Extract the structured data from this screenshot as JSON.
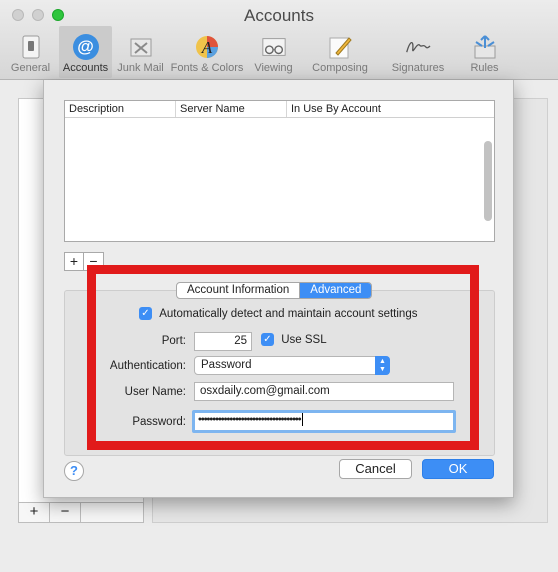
{
  "window": {
    "title": "Accounts"
  },
  "toolbar": {
    "items": [
      {
        "label": "General",
        "icon": "general-switch-icon"
      },
      {
        "label": "Accounts",
        "icon": "at-sign-icon",
        "selected": true
      },
      {
        "label": "Junk Mail",
        "icon": "junk-mail-icon"
      },
      {
        "label": "Fonts & Colors",
        "icon": "fonts-colors-icon"
      },
      {
        "label": "Viewing",
        "icon": "glasses-icon"
      },
      {
        "label": "Composing",
        "icon": "pencil-icon"
      },
      {
        "label": "Signatures",
        "icon": "signature-icon"
      },
      {
        "label": "Rules",
        "icon": "rules-arrows-icon"
      }
    ]
  },
  "smtp_table": {
    "columns": [
      "Description",
      "Server Name",
      "In Use By Account"
    ],
    "rows": []
  },
  "list_buttons": {
    "add": "+",
    "remove": "−"
  },
  "tabs": {
    "items": [
      "Account Information",
      "Advanced"
    ],
    "active": "Advanced"
  },
  "form": {
    "auto_detect_label": "Automatically detect and maintain account settings",
    "auto_detect_checked": true,
    "port_label": "Port:",
    "port_value": "25",
    "use_ssl_label": "Use SSL",
    "use_ssl_checked": true,
    "auth_label": "Authentication:",
    "auth_value": "Password",
    "username_label": "User Name:",
    "username_value": "osxdaily.com@gmail.com",
    "password_label": "Password:",
    "password_value": "••••••••••••••••••••••••••••••••••••"
  },
  "footer": {
    "help": "?",
    "cancel": "Cancel",
    "ok": "OK"
  },
  "colors": {
    "accent": "#3d8ef5",
    "highlight": "#e11a1a"
  }
}
